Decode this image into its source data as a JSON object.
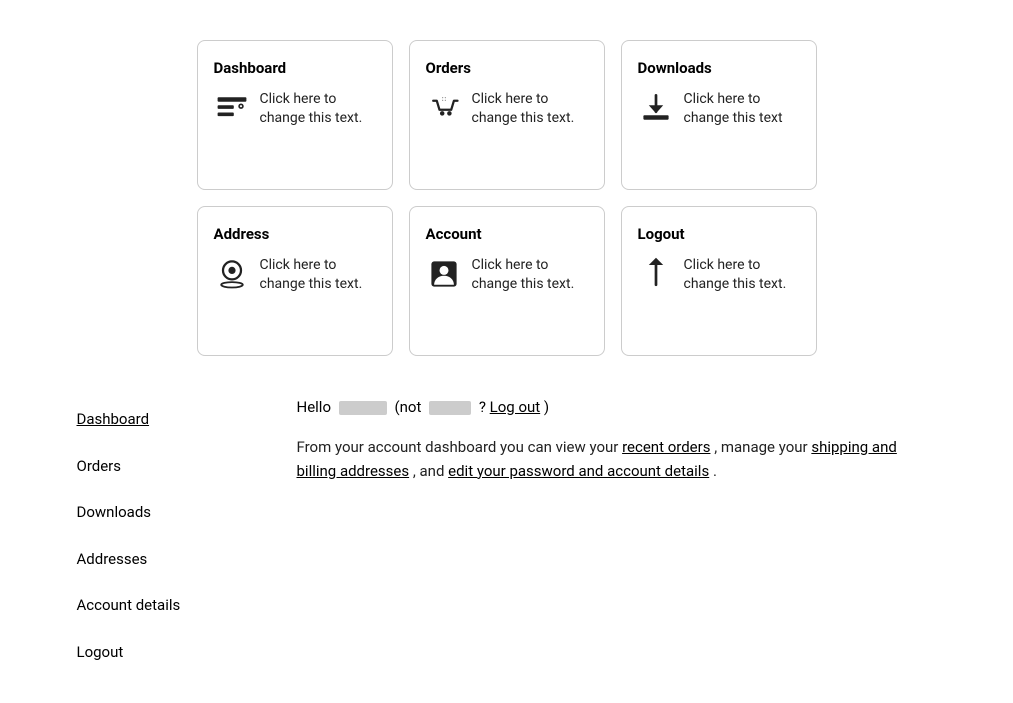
{
  "cards": [
    {
      "id": "dashboard",
      "title": "Dashboard",
      "text": "Click here to change this text.",
      "icon": "dashboard"
    },
    {
      "id": "orders",
      "title": "Orders",
      "text": "Click here to change this text.",
      "icon": "orders"
    },
    {
      "id": "downloads",
      "title": "Downloads",
      "text": "Click here to change this text",
      "icon": "downloads"
    },
    {
      "id": "address",
      "title": "Address",
      "text": "Click here to change this text.",
      "icon": "address"
    },
    {
      "id": "account",
      "title": "Account",
      "text": "Click here to change this text.",
      "icon": "account"
    },
    {
      "id": "logout",
      "title": "Logout",
      "text": "Click here to change this text.",
      "icon": "logout"
    }
  ],
  "sidebar": {
    "items": [
      {
        "id": "dashboard",
        "label": "Dashboard",
        "active": true
      },
      {
        "id": "orders",
        "label": "Orders",
        "active": false
      },
      {
        "id": "downloads",
        "label": "Downloads",
        "active": false
      },
      {
        "id": "addresses",
        "label": "Addresses",
        "active": false
      },
      {
        "id": "account-details",
        "label": "Account details",
        "active": false
      },
      {
        "id": "logout",
        "label": "Logout",
        "active": false
      }
    ]
  },
  "main": {
    "hello_prefix": "Hello",
    "hello_not": "(not",
    "hello_question": "?",
    "hello_logout": "Log out",
    "hello_close": ")",
    "description_part1": "From your account dashboard you can view your ",
    "description_link1": "recent orders",
    "description_part2": ", manage your ",
    "description_link2": "shipping and billing addresses",
    "description_part3": ", and ",
    "description_link3": "edit your password and account details",
    "description_part4": "."
  }
}
